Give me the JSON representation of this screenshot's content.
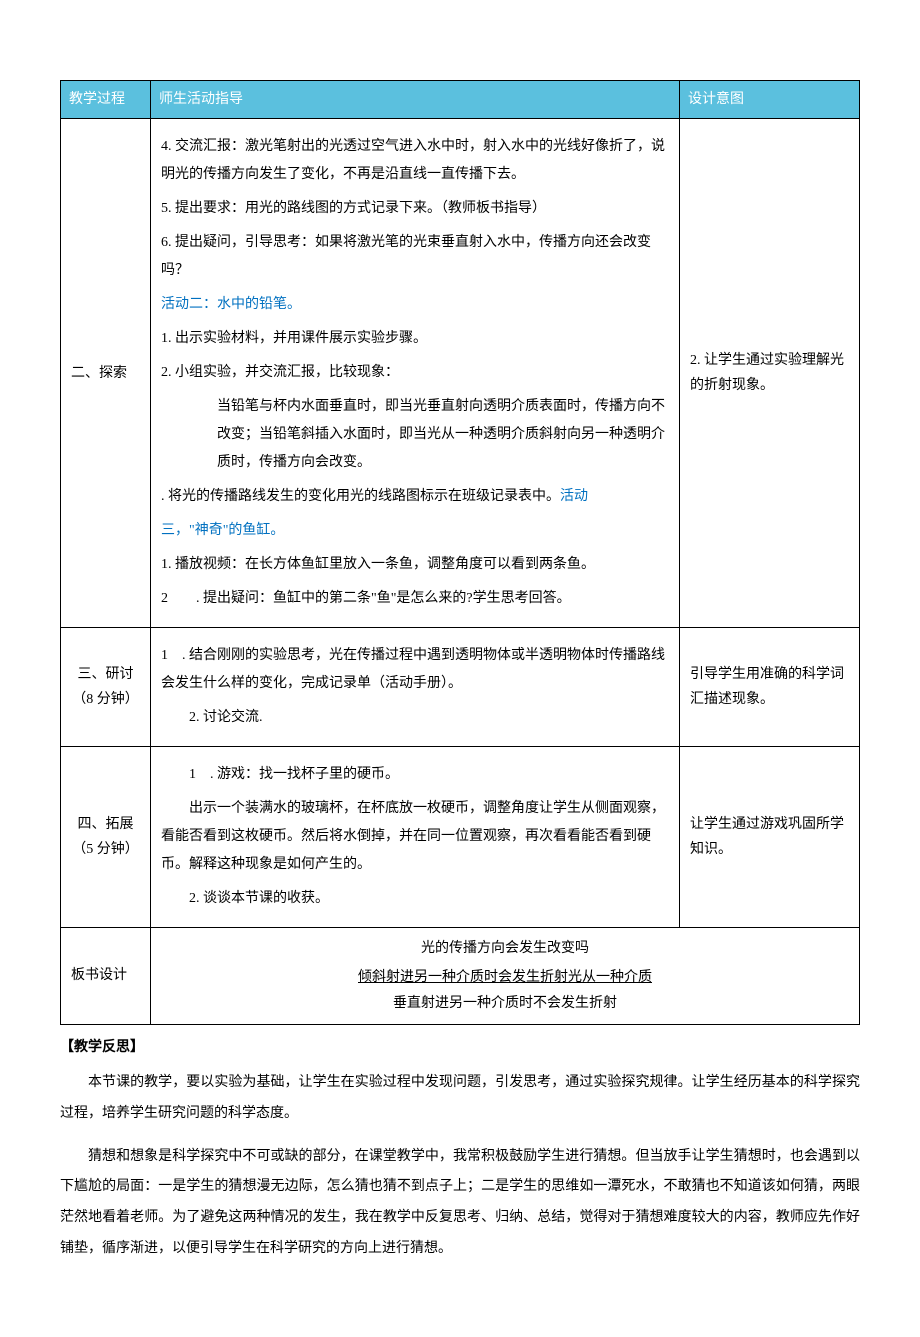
{
  "headers": {
    "col1": "教学过程",
    "col2": "师生活动指导",
    "col3": "设计意图"
  },
  "row1": {
    "label": "二、探索",
    "content": {
      "p4": "4. 交流汇报：激光笔射出的光透过空气进入水中时，射入水中的光线好像折了，说明光的传播方向发生了变化，不再是沿直线一直传播下去。",
      "p5": "5. 提出要求：用光的路线图的方式记录下来。（教师板书指导）",
      "p6": "6. 提出疑问，引导思考：如果将激光笔的光束垂直射入水中，传播方向还会改变吗？",
      "act2_title": "活动二：水中的铅笔。",
      "act2_1": "1. 出示实验材料，并用课件展示实验步骤。",
      "act2_2": "2. 小组实验，并交流汇报，比较现象：",
      "act2_2detail": "当铅笔与杯内水面垂直时，即当光垂直射向透明介质表面时，传播方向不改变；当铅笔斜插入水面时，即当光从一种透明介质斜射向另一种透明介质时，传播方向会改变。",
      "act2_3a": ". 将光的传播路线发生的变化用光的线路图标示在班级记录表中。",
      "act3_title_a": "活动",
      "act3_title_b": "三，\"神奇\"的鱼缸。",
      "act3_1": "1. 播放视频：在长方体鱼缸里放入一条鱼，调整角度可以看到两条鱼。",
      "act3_2a": "2",
      "act3_2b": ". 提出疑问：鱼缸中的第二条\"鱼\"是怎么来的?学生思考回答。"
    },
    "intent": "2. 让学生通过实验理解光的折射现象。"
  },
  "row2": {
    "label": "三、研讨（8 分钟）",
    "content": {
      "p1a": "1",
      "p1b": ". 结合刚刚的实验思考，光在传播过程中遇到透明物体或半透明物体时传播路线会发生什么样的变化，完成记录单（活动手册）。",
      "p2": "2. 讨论交流."
    },
    "intent": "引导学生用准确的科学词汇描述现象。"
  },
  "row3": {
    "label": "四、拓展（5 分钟）",
    "content": {
      "p1a": "1",
      "p1b": ". 游戏：找一找杯子里的硬币。",
      "p1detail": "出示一个装满水的玻璃杯，在杯底放一枚硬币，调整角度让学生从侧面观察，看能否看到这枚硬币。然后将水倒掉，并在同一位置观察，再次看看能否看到硬币。解释这种现象是如何产生的。",
      "p2": "2. 谈谈本节课的收获。"
    },
    "intent": "让学生通过游戏巩固所学知识。"
  },
  "row4": {
    "label": "板书设计",
    "content": {
      "title": "光的传播方向会发生改变吗",
      "line1": "倾斜射进另一种介质时会发生折射光从一种介质",
      "line2pre": "垂直射进另一种介质时不会发生折射"
    }
  },
  "reflection": {
    "title": "【教学反思】",
    "p1": "本节课的教学，要以实验为基础，让学生在实验过程中发现问题，引发思考，通过实验探究规律。让学生经历基本的科学探究过程，培养学生研究问题的科学态度。",
    "p2": "猜想和想象是科学探究中不可或缺的部分，在课堂教学中，我常积极鼓励学生进行猜想。但当放手让学生猜想时，也会遇到以下尴尬的局面：一是学生的猜想漫无边际，怎么猜也猜不到点子上；二是学生的思维如一潭死水，不敢猜也不知道该如何猜，两眼茫然地看着老师。为了避免这两种情况的发生，我在教学中反复思考、归纳、总结，觉得对于猜想难度较大的内容，教师应先作好铺垫，循序渐进，以便引导学生在科学研究的方向上进行猜想。"
  }
}
